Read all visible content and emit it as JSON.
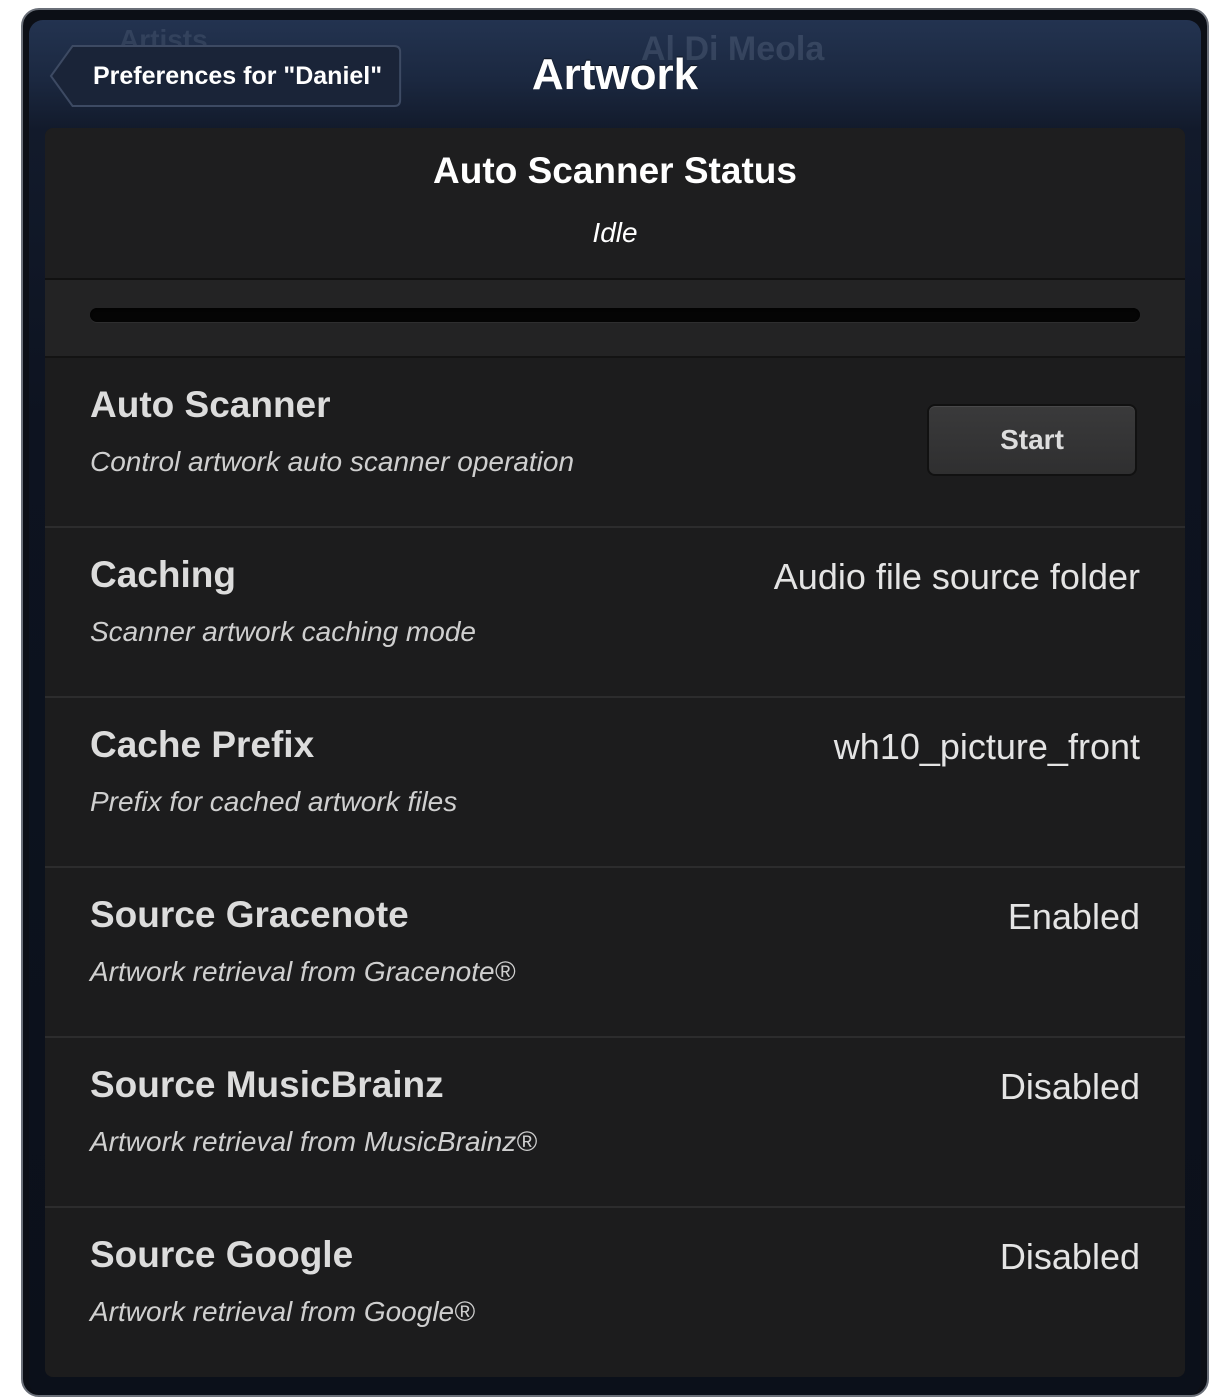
{
  "navbar": {
    "back_label": "Preferences for \"Daniel\"",
    "title": "Artwork",
    "background_text_right": "Al Di Meola",
    "background_text_left": "Artists"
  },
  "status": {
    "title": "Auto Scanner Status",
    "value": "Idle",
    "progress": 0
  },
  "rows": [
    {
      "title": "Auto Scanner",
      "subtitle": "Control artwork auto scanner operation",
      "button_label": "Start"
    },
    {
      "title": "Caching",
      "subtitle": "Scanner artwork caching mode",
      "value": "Audio file source folder"
    },
    {
      "title": "Cache Prefix",
      "subtitle": "Prefix for cached artwork files",
      "value": "wh10_picture_front"
    },
    {
      "title": "Source Gracenote",
      "subtitle": "Artwork retrieval from Gracenote®",
      "value": "Enabled"
    },
    {
      "title": "Source MusicBrainz",
      "subtitle": "Artwork retrieval from MusicBrainz®",
      "value": "Disabled"
    },
    {
      "title": "Source Google",
      "subtitle": "Artwork retrieval from Google®",
      "value": "Disabled"
    }
  ],
  "colors": {
    "navbar": "#1b2840",
    "panel": "#1c1c1d",
    "text": "#dcdcdc",
    "progress_fill": "#3d7ad6"
  }
}
